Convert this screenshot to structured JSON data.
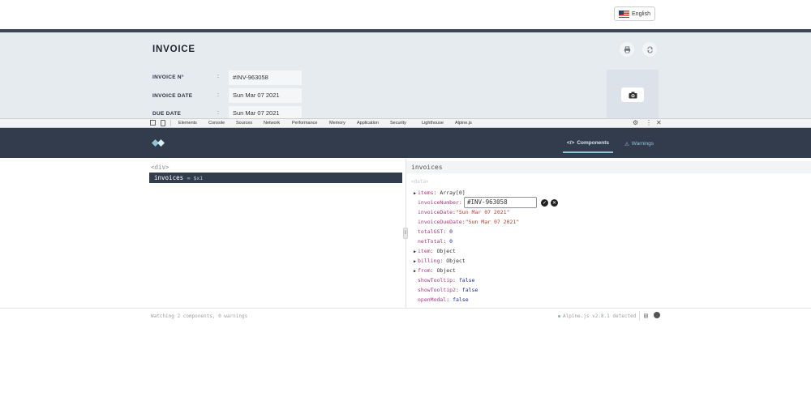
{
  "page": {
    "language_button": "English"
  },
  "invoice": {
    "title": "INVOICE",
    "rows": [
      {
        "label": "INVOICE N°",
        "colon": ":",
        "value": "#INV-963058"
      },
      {
        "label": "INVOICE DATE",
        "colon": ":",
        "value": "Sun Mar 07 2021"
      },
      {
        "label": "DUE DATE",
        "colon": ":",
        "value": "Sun Mar 07 2021"
      }
    ],
    "icons": [
      "print-icon",
      "refresh-icon",
      "camera-icon"
    ]
  },
  "devtools": {
    "tabs": [
      "Elements",
      "Console",
      "Sources",
      "Network",
      "Performance",
      "Memory",
      "Application",
      "Security",
      "Lighthouse",
      "Alpine.js"
    ],
    "active_tab": "Alpine.js"
  },
  "alpine": {
    "tabs": {
      "components": "Components",
      "warnings": "Warnings"
    },
    "tree": {
      "root": "<div>",
      "selected": "invoices",
      "selected_suffix": "= $x1"
    },
    "panel_title": "invoices",
    "data_label": "<data>",
    "properties": [
      {
        "expandable": true,
        "key": "items",
        "sep": ": ",
        "value": "Array[0]",
        "kind": "plain"
      },
      {
        "expandable": false,
        "key": "invoiceNumber",
        "sep": ":",
        "value": "",
        "kind": "edit"
      },
      {
        "expandable": false,
        "key": "invoiceDate",
        "sep": ":",
        "value": "\"Sun Mar 07 2021\"",
        "kind": "str"
      },
      {
        "expandable": false,
        "key": "invoiceDueDate",
        "sep": ":",
        "value": "\"Sun Mar 07 2021\"",
        "kind": "str"
      },
      {
        "expandable": false,
        "key": "totalGST",
        "sep": ": ",
        "value": "0",
        "kind": "num"
      },
      {
        "expandable": false,
        "key": "netTotal",
        "sep": ": ",
        "value": "0",
        "kind": "num"
      },
      {
        "expandable": true,
        "key": "item",
        "sep": ": ",
        "value": "Object",
        "kind": "plain"
      },
      {
        "expandable": true,
        "key": "billing",
        "sep": ": ",
        "value": "Object",
        "kind": "plain"
      },
      {
        "expandable": true,
        "key": "from",
        "sep": ": ",
        "value": "Object",
        "kind": "plain"
      },
      {
        "expandable": false,
        "key": "showTooltip",
        "sep": ": ",
        "value": "false",
        "kind": "bool"
      },
      {
        "expandable": false,
        "key": "showTooltip2",
        "sep": ": ",
        "value": "false",
        "kind": "bool"
      },
      {
        "expandable": false,
        "key": "openModal",
        "sep": ": ",
        "value": "false",
        "kind": "bool"
      }
    ],
    "edit_value": "#INV-963058",
    "footer_left": "Watching 2 components, 0 warnings",
    "footer_right": "Alpine.js v2.8.1 detected"
  },
  "colors": {
    "alpine_header": "#333c4d",
    "accent": "#8ec5d6",
    "key": "#b5317c",
    "string": "#c0392b"
  }
}
